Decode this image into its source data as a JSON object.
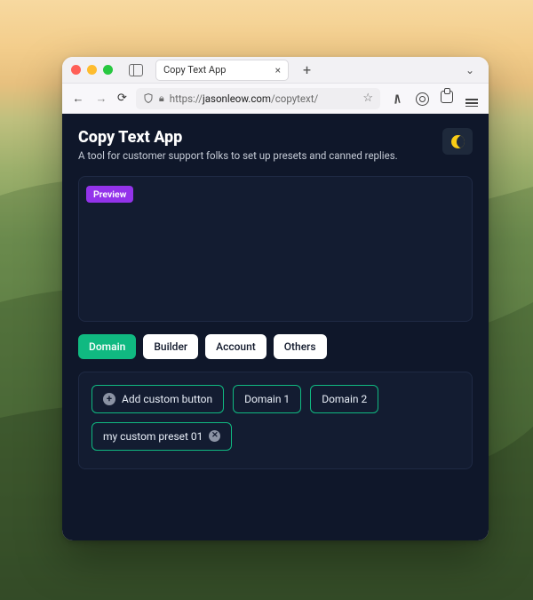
{
  "browser": {
    "tab_title": "Copy Text App",
    "url_prefix": "https://",
    "url_host": "jasonleow.com",
    "url_path": "/copytext/"
  },
  "app": {
    "title": "Copy Text App",
    "subtitle": "A tool for customer support folks to set up presets and canned replies.",
    "preview_badge": "Preview"
  },
  "tabs": [
    {
      "label": "Domain",
      "active": true
    },
    {
      "label": "Builder",
      "active": false
    },
    {
      "label": "Account",
      "active": false
    },
    {
      "label": "Others",
      "active": false
    }
  ],
  "presets": {
    "add_label": "Add custom button",
    "items": [
      {
        "label": "Domain 1",
        "removable": false
      },
      {
        "label": "Domain 2",
        "removable": false
      },
      {
        "label": "my custom preset 01",
        "removable": true
      }
    ]
  }
}
